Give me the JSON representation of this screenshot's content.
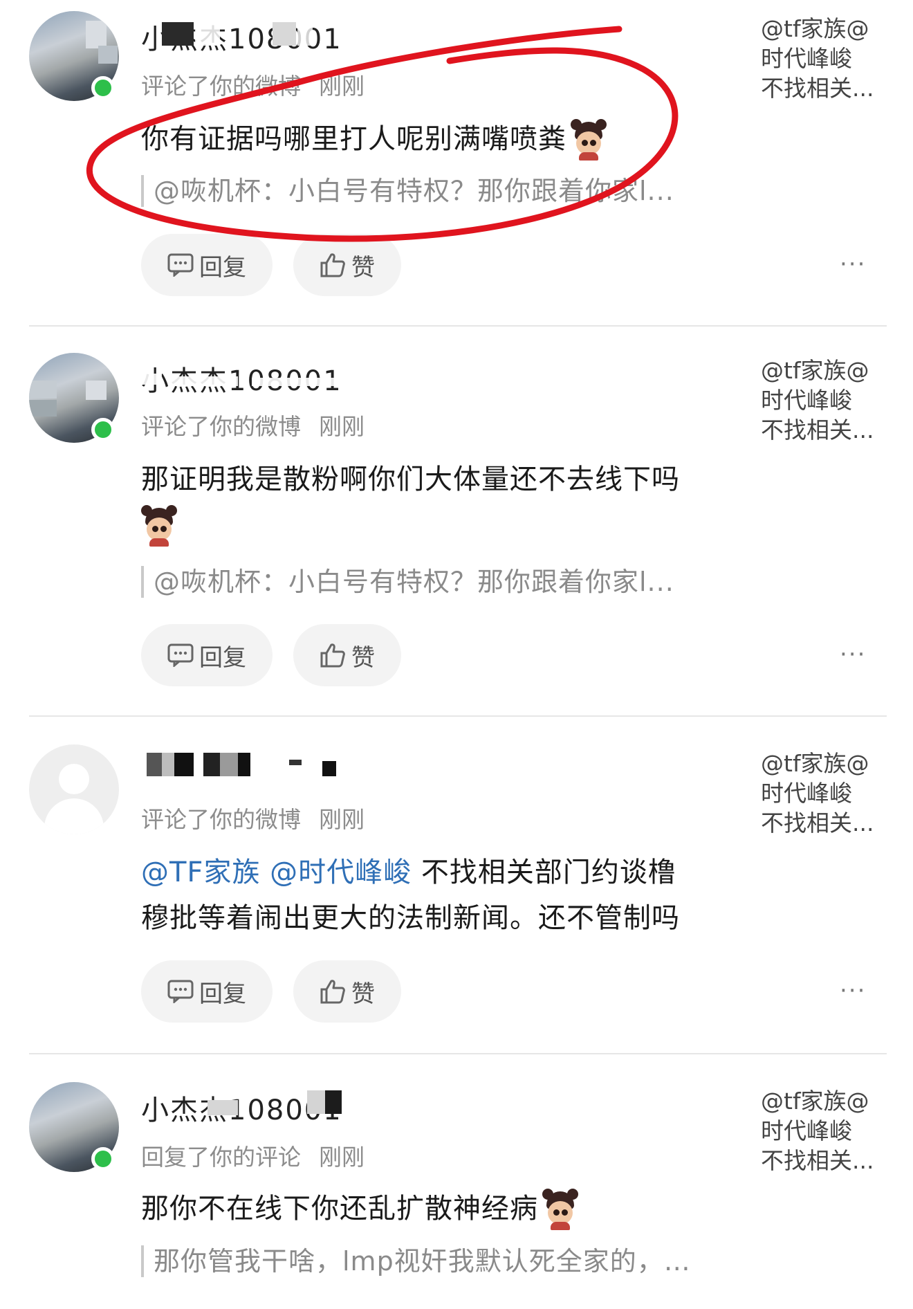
{
  "comments": [
    {
      "name": "小杰杰108001",
      "action": "评论了你的微博",
      "time": "刚刚",
      "ref": [
        "@tf家族@",
        "时代峰峻",
        "不找相关..."
      ],
      "content": "你有证据吗哪里打人呢别满嘴喷粪",
      "quote": "@咴机杯：小白号有特权？那你跟着你家l...",
      "reply_label": "回复",
      "like_label": "赞",
      "avatar_online": true
    },
    {
      "name": "小杰杰108001",
      "action": "评论了你的微博",
      "time": "刚刚",
      "ref": [
        "@tf家族@",
        "时代峰峻",
        "不找相关..."
      ],
      "content": "那证明我是散粉啊你们大体量还不去线下吗",
      "quote": "@咴机杯：小白号有特权？那你跟着你家l...",
      "reply_label": "回复",
      "like_label": "赞",
      "avatar_online": true
    },
    {
      "name": "",
      "action": "评论了你的微博",
      "time": "刚刚",
      "ref": [
        "@tf家族@",
        "时代峰峻",
        "不找相关..."
      ],
      "content_mentions": [
        "@TF家族",
        "@时代峰峻"
      ],
      "content_line1": "不找相关部门约谈橹",
      "content_line2": "穆批等着闹出更大的法制新闻。还不管制吗",
      "reply_label": "回复",
      "like_label": "赞",
      "avatar_online": false
    },
    {
      "name": "小杰杰108001",
      "action": "回复了你的评论",
      "time": "刚刚",
      "ref": [
        "@tf家族@",
        "时代峰峻",
        "不找相关..."
      ],
      "content": "那你不在线下你还乱扩散神经病",
      "quote": "那你管我干啥，lmp视奸我默认死全家的，…",
      "avatar_online": true
    }
  ],
  "more_label": "···",
  "colors": {
    "mention": "#2f6fb6",
    "online_dot": "#2dbf4a",
    "annotation": "#e0141e",
    "meta_text": "#8c8c8c"
  },
  "icons": [
    "comment-icon",
    "thumbs-up-icon",
    "more-icon",
    "emoji-girl-icon"
  ]
}
